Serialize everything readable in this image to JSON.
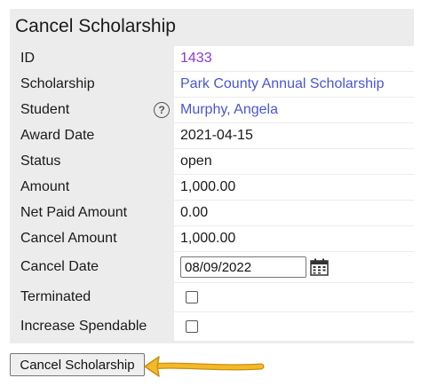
{
  "form": {
    "title": "Cancel Scholarship",
    "fields": {
      "id": {
        "label": "ID",
        "value": "1433"
      },
      "scholarship": {
        "label": "Scholarship",
        "value": "Park County Annual Scholarship"
      },
      "student": {
        "label": "Student",
        "help": "?",
        "value": "Murphy, Angela"
      },
      "award_date": {
        "label": "Award Date",
        "value": "2021-04-15"
      },
      "status": {
        "label": "Status",
        "value": "open"
      },
      "amount": {
        "label": "Amount",
        "value": "1,000.00"
      },
      "net_paid_amount": {
        "label": "Net Paid Amount",
        "value": "0.00"
      },
      "cancel_amount": {
        "label": "Cancel Amount",
        "value": "1,000.00"
      },
      "cancel_date": {
        "label": "Cancel Date",
        "value": "08/09/2022",
        "icon": "calendar-icon"
      },
      "terminated": {
        "label": "Terminated",
        "checked": false
      },
      "increase_spendable": {
        "label": "Increase Spendable",
        "checked": false
      }
    },
    "submit_label": "Cancel Scholarship"
  },
  "annotation": {
    "icon": "arrow-left-icon",
    "color": "#f0b323"
  },
  "colors": {
    "link": "#4a55d6",
    "visited_link": "#8a37d6",
    "label_bg": "#ececec"
  }
}
